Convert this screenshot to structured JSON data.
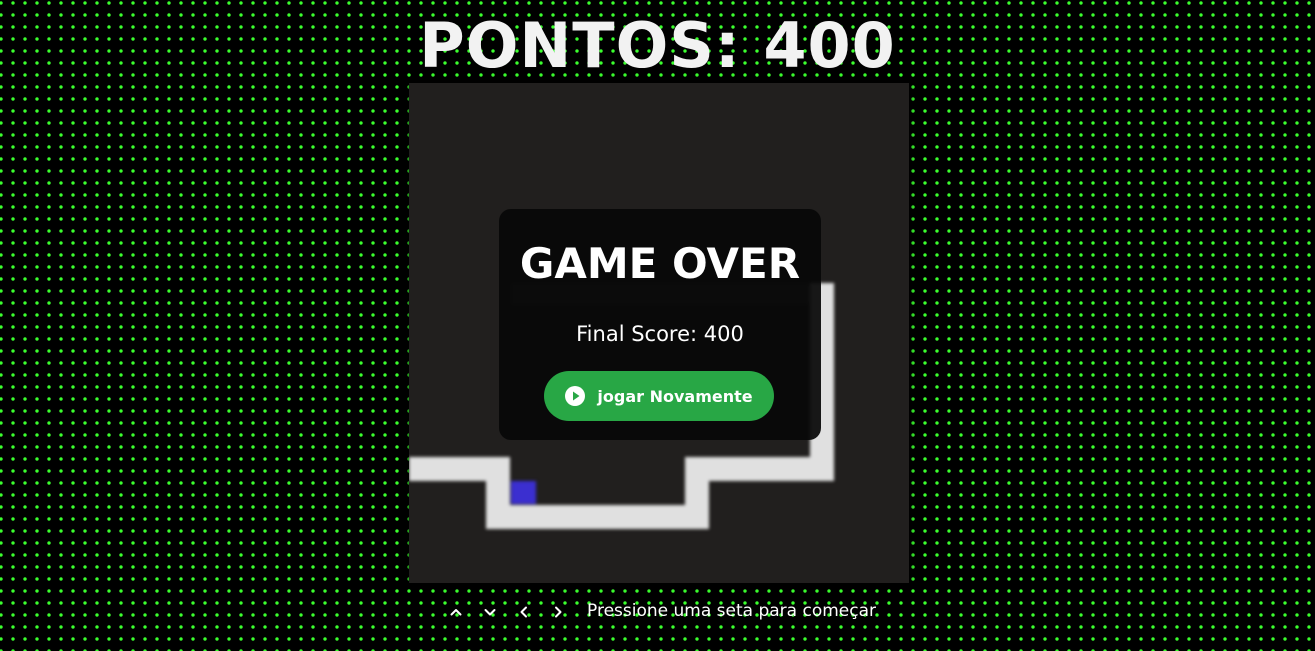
{
  "header": {
    "score_label": "PONTOS: 400"
  },
  "game_over": {
    "title": "GAME OVER",
    "final_score": "Final Score: 400",
    "play_again_label": "jogar Novamente"
  },
  "controls": {
    "hint": "Pressione uma seta para começar",
    "arrows": [
      "up-arrow-icon",
      "down-arrow-icon",
      "left-arrow-icon",
      "right-arrow-icon"
    ]
  },
  "colors": {
    "background": "#000000",
    "grid_dots": "#3bff2e",
    "board": "#211f1e",
    "snake": "#e0e0e0",
    "food": "#3b2fd0",
    "button": "#28a745"
  }
}
